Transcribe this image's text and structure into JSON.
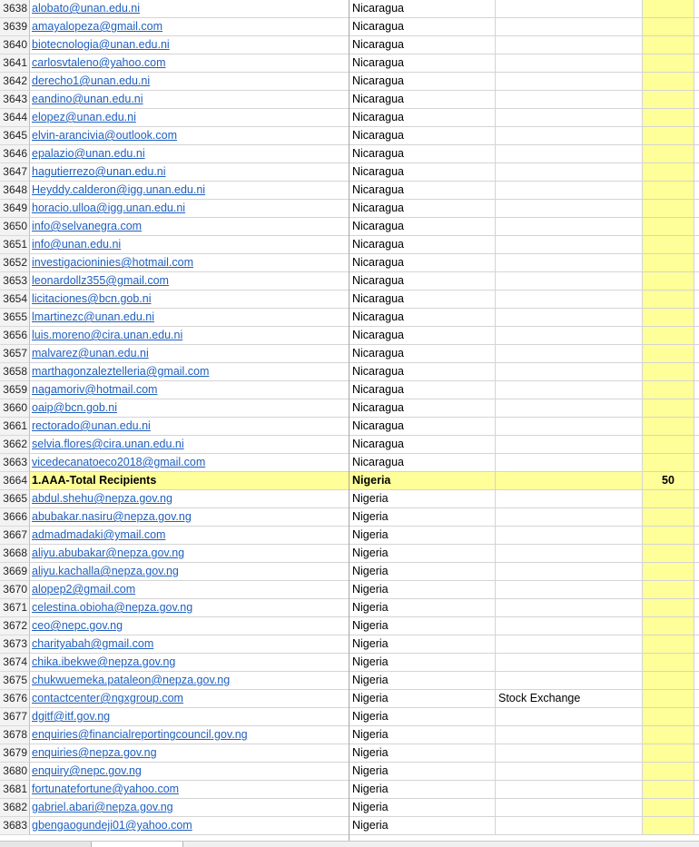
{
  "sheet": {
    "rows": [
      {
        "num": "3638",
        "email": "alobato@unan.edu.ni",
        "country": "Nicaragua",
        "org": "",
        "count": ""
      },
      {
        "num": "3639",
        "email": "amayalopeza@gmail.com",
        "country": "Nicaragua",
        "org": "",
        "count": ""
      },
      {
        "num": "3640",
        "email": "biotecnologia@unan.edu.ni",
        "country": "Nicaragua",
        "org": "",
        "count": ""
      },
      {
        "num": "3641",
        "email": "carlosvtaleno@yahoo.com",
        "country": "Nicaragua",
        "org": "",
        "count": ""
      },
      {
        "num": "3642",
        "email": "derecho1@unan.edu.ni",
        "country": "Nicaragua",
        "org": "",
        "count": ""
      },
      {
        "num": "3643",
        "email": "eandino@unan.edu.ni",
        "country": "Nicaragua",
        "org": "",
        "count": ""
      },
      {
        "num": "3644",
        "email": "elopez@unan.edu.ni",
        "country": "Nicaragua",
        "org": "",
        "count": ""
      },
      {
        "num": "3645",
        "email": "elvin-arancivia@outlook.com",
        "country": "Nicaragua",
        "org": "",
        "count": ""
      },
      {
        "num": "3646",
        "email": "epalazio@unan.edu.ni",
        "country": "Nicaragua",
        "org": "",
        "count": ""
      },
      {
        "num": "3647",
        "email": "hagutierrezo@unan.edu.ni",
        "country": "Nicaragua",
        "org": "",
        "count": ""
      },
      {
        "num": "3648",
        "email": "Heyddy.calderon@igg.unan.edu.ni",
        "country": "Nicaragua",
        "org": "",
        "count": ""
      },
      {
        "num": "3649",
        "email": "horacio.ulloa@igg.unan.edu.ni",
        "country": "Nicaragua",
        "org": "",
        "count": ""
      },
      {
        "num": "3650",
        "email": "info@selvanegra.com",
        "country": "Nicaragua",
        "org": "",
        "count": ""
      },
      {
        "num": "3651",
        "email": "info@unan.edu.ni",
        "country": "Nicaragua",
        "org": "",
        "count": ""
      },
      {
        "num": "3652",
        "email": "investigacioninies@hotmail.com",
        "country": "Nicaragua",
        "org": "",
        "count": ""
      },
      {
        "num": "3653",
        "email": "leonardollz355@gmail.com",
        "country": "Nicaragua",
        "org": "",
        "count": ""
      },
      {
        "num": "3654",
        "email": "licitaciones@bcn.gob.ni",
        "country": "Nicaragua",
        "org": "",
        "count": ""
      },
      {
        "num": "3655",
        "email": "lmartinezc@unan.edu.ni",
        "country": "Nicaragua",
        "org": "",
        "count": ""
      },
      {
        "num": "3656",
        "email": "luis.moreno@cira.unan.edu.ni",
        "country": "Nicaragua",
        "org": "",
        "count": ""
      },
      {
        "num": "3657",
        "email": "malvarez@unan.edu.ni",
        "country": "Nicaragua",
        "org": "",
        "count": ""
      },
      {
        "num": "3658",
        "email": "marthagonzaleztelleria@gmail.com",
        "country": "Nicaragua",
        "org": "",
        "count": ""
      },
      {
        "num": "3659",
        "email": "nagamoriv@hotmail.com",
        "country": "Nicaragua",
        "org": "",
        "count": ""
      },
      {
        "num": "3660",
        "email": "oaip@bcn.gob.ni",
        "country": "Nicaragua",
        "org": "",
        "count": ""
      },
      {
        "num": "3661",
        "email": "rectorado@unan.edu.ni",
        "country": "Nicaragua",
        "org": "",
        "count": ""
      },
      {
        "num": "3662",
        "email": "selvia.flores@cira.unan.edu.ni",
        "country": "Nicaragua",
        "org": "",
        "count": ""
      },
      {
        "num": "3663",
        "email": "vicedecanatoeco2018@gmail.com",
        "country": "Nicaragua",
        "org": "",
        "count": ""
      },
      {
        "num": "3664",
        "email": "1.AAA-Total Recipients",
        "country": "Nigeria",
        "org": "",
        "count": "50",
        "total": true
      },
      {
        "num": "3665",
        "email": "abdul.shehu@nepza.gov.ng",
        "country": "Nigeria",
        "org": "",
        "count": ""
      },
      {
        "num": "3666",
        "email": "abubakar.nasiru@nepza.gov.ng",
        "country": "Nigeria",
        "org": "",
        "count": ""
      },
      {
        "num": "3667",
        "email": "admadmadaki@ymail.com",
        "country": "Nigeria",
        "org": "",
        "count": ""
      },
      {
        "num": "3668",
        "email": "aliyu.abubakar@nepza.gov.ng",
        "country": "Nigeria",
        "org": "",
        "count": ""
      },
      {
        "num": "3669",
        "email": "aliyu.kachalla@nepza.gov.ng",
        "country": "Nigeria",
        "org": "",
        "count": ""
      },
      {
        "num": "3670",
        "email": "alopep2@gmail.com",
        "country": "Nigeria",
        "org": "",
        "count": ""
      },
      {
        "num": "3671",
        "email": "celestina.obioha@nepza.gov.ng",
        "country": "Nigeria",
        "org": "",
        "count": ""
      },
      {
        "num": "3672",
        "email": "ceo@nepc.gov.ng",
        "country": "Nigeria",
        "org": "",
        "count": ""
      },
      {
        "num": "3673",
        "email": "charityabah@gmail.com",
        "country": "Nigeria",
        "org": "",
        "count": ""
      },
      {
        "num": "3674",
        "email": "chika.ibekwe@nepza.gov.ng",
        "country": "Nigeria",
        "org": "",
        "count": ""
      },
      {
        "num": "3675",
        "email": "chukwuemeka.pataleon@nepza.gov.ng",
        "country": "Nigeria",
        "org": "",
        "count": ""
      },
      {
        "num": "3676",
        "email": "contactcenter@ngxgroup.com",
        "country": "Nigeria",
        "org": "Stock Exchange",
        "count": ""
      },
      {
        "num": "3677",
        "email": "dgitf@itf.gov.ng",
        "country": "Nigeria",
        "org": "",
        "count": ""
      },
      {
        "num": "3678",
        "email": "enquiries@financialreportingcouncil.gov.ng",
        "country": "Nigeria",
        "org": "",
        "count": ""
      },
      {
        "num": "3679",
        "email": "enquiries@nepza.gov.ng",
        "country": "Nigeria",
        "org": "",
        "count": ""
      },
      {
        "num": "3680",
        "email": "enquiry@nepc.gov.ng",
        "country": "Nigeria",
        "org": "",
        "count": ""
      },
      {
        "num": "3681",
        "email": "fortunatefortune@yahoo.com",
        "country": "Nigeria",
        "org": "",
        "count": ""
      },
      {
        "num": "3682",
        "email": "gabriel.abari@nepza.gov.ng",
        "country": "Nigeria",
        "org": "",
        "count": ""
      },
      {
        "num": "3683",
        "email": "gbengaogundeji01@yahoo.com",
        "country": "Nigeria",
        "org": "",
        "count": ""
      }
    ]
  },
  "colors": {
    "highlight": "#ffff99",
    "link": "#1f5fbf",
    "gridline": "#d4d4d4"
  }
}
